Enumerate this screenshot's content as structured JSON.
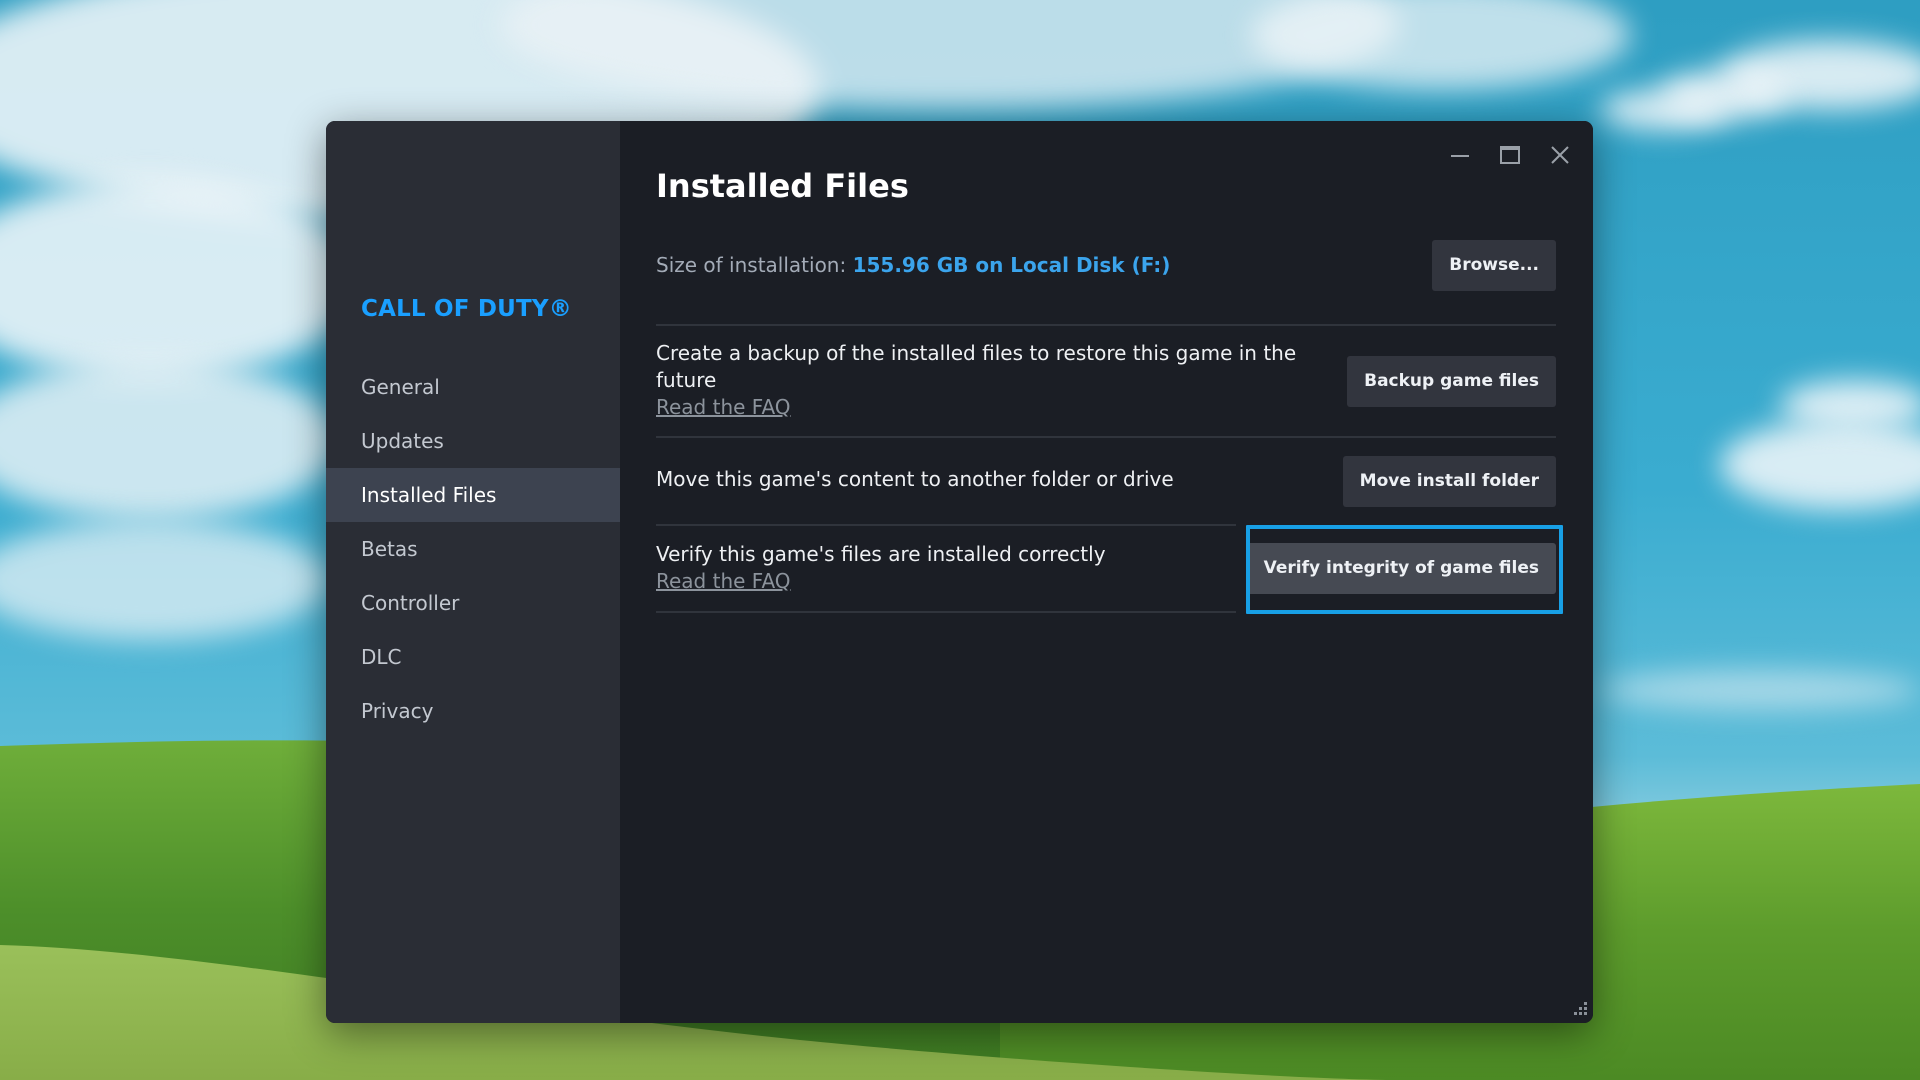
{
  "window": {
    "controls": {
      "minimize": "minimize-icon",
      "maximize": "maximize-icon",
      "close": "close-icon"
    }
  },
  "sidebar": {
    "game_title": "CALL OF DUTY®",
    "items": [
      {
        "label": "General",
        "active": false
      },
      {
        "label": "Updates",
        "active": false
      },
      {
        "label": "Installed Files",
        "active": true
      },
      {
        "label": "Betas",
        "active": false
      },
      {
        "label": "Controller",
        "active": false
      },
      {
        "label": "DLC",
        "active": false
      },
      {
        "label": "Privacy",
        "active": false
      }
    ]
  },
  "main": {
    "title": "Installed Files",
    "size": {
      "label": "Size of installation:",
      "value": "155.96 GB on Local Disk (F:)",
      "browse_label": "Browse..."
    },
    "sections": [
      {
        "description": "Create a backup of the installed files to restore this game in the future",
        "link": "Read the FAQ",
        "button": "Backup game files"
      },
      {
        "description": "Move this game's content to another folder or drive",
        "button": "Move install folder"
      },
      {
        "description": "Verify this game's files are installed correctly",
        "link": "Read the FAQ",
        "button": "Verify integrity of game files",
        "highlighted": true
      }
    ]
  },
  "colors": {
    "accent": "#1a9fff",
    "link_blue": "#3ba4ec",
    "highlight_border": "#18a0e6",
    "sidebar_bg": "#2a2d35",
    "main_bg": "#1b1e25",
    "active_item_bg": "#3d4350"
  }
}
